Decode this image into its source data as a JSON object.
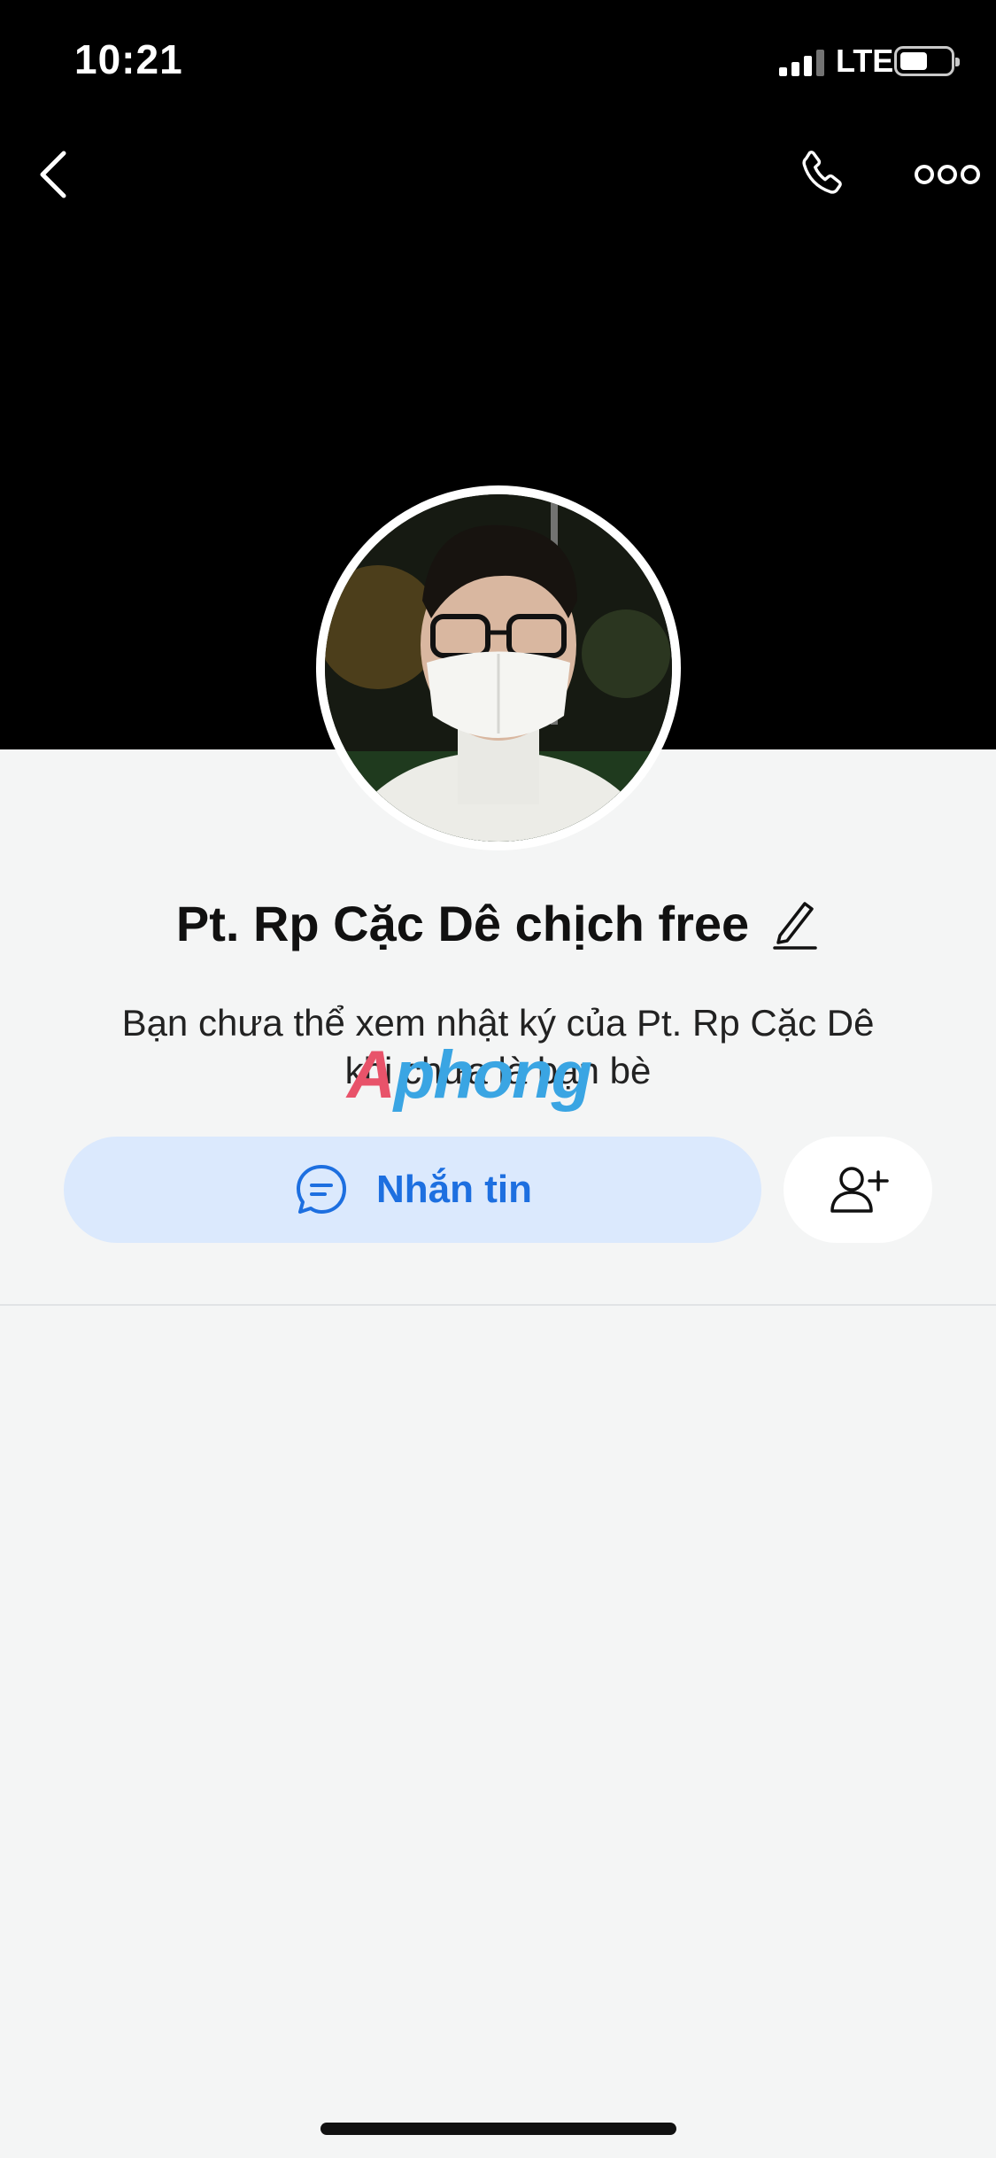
{
  "status_bar": {
    "time": "10:21",
    "carrier": "LTE"
  },
  "header": {
    "back_icon": "chevron-left-icon",
    "call_icon": "phone-icon",
    "more_icon": "more-horizontal-icon"
  },
  "profile": {
    "name": "Pt. Rp Cặc Dê chịch free",
    "note_line1": "Bạn chưa thể xem nhật ký của Pt. Rp Cặc Dê",
    "note_line2": "khi chưa là bạn bè"
  },
  "actions": {
    "message_label": "Nhắn tin",
    "message_icon": "chat-bubble-icon",
    "add_friend_icon": "add-user-icon"
  },
  "watermark": {
    "part1": "A",
    "part2": "phong"
  },
  "colors": {
    "accent": "#1d6fe0",
    "message_button_bg": "#dbe9fd",
    "cover": "#000000",
    "page_bg": "#f4f5f5"
  }
}
